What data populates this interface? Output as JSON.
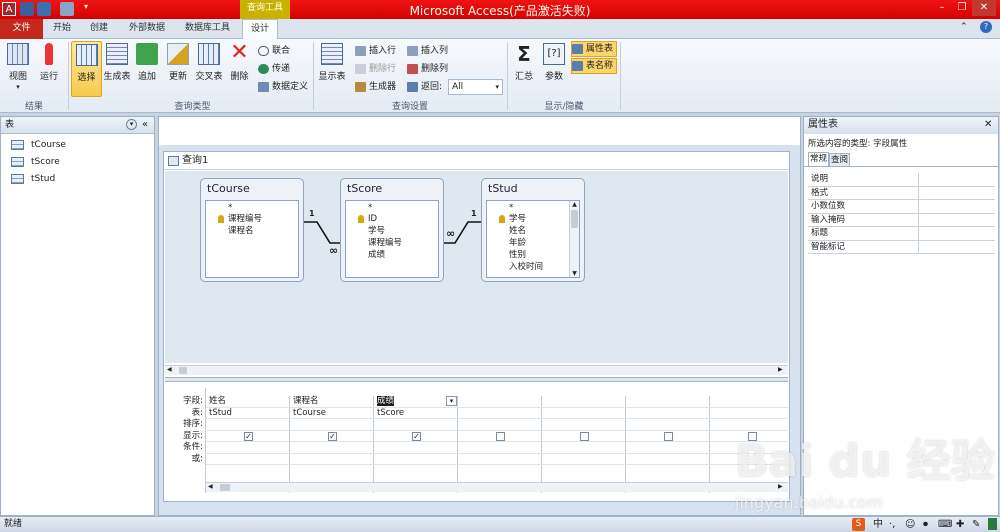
{
  "window": {
    "title": "Microsoft Access(产品激活失败)",
    "context_tab_title": "查询工具"
  },
  "tabs": [
    "文件",
    "开始",
    "创建",
    "外部数据",
    "数据库工具",
    "设计"
  ],
  "ribbon": {
    "groups": {
      "results": "结果",
      "query_type": "查询类型",
      "query_setup": "查询设置",
      "show_hide": "显示/隐藏"
    },
    "results": [
      "视图",
      "运行"
    ],
    "query_type": [
      "选择",
      "生成表",
      "追加",
      "更新",
      "交叉表",
      "删除"
    ],
    "query_type_small": [
      "联合",
      "传递",
      "数据定义"
    ],
    "show_table": "显示表",
    "setup_small": [
      "插入行",
      "删除行",
      "生成器",
      "插入列",
      "删除列",
      "返回:"
    ],
    "return_value": "All",
    "show_hide_big": [
      "汇总",
      "参数"
    ],
    "show_hide_small": [
      "属性表",
      "表名称"
    ]
  },
  "nav": {
    "header": "表",
    "items": [
      "tCourse",
      "tScore",
      "tStud"
    ]
  },
  "query": {
    "title": "查询1",
    "tables": [
      {
        "name": "tCourse",
        "fields": [
          "*",
          "课程编号",
          "课程名"
        ]
      },
      {
        "name": "tScore",
        "fields": [
          "*",
          "ID",
          "学号",
          "课程编号",
          "成绩"
        ]
      },
      {
        "name": "tStud",
        "fields": [
          "*",
          "学号",
          "姓名",
          "年龄",
          "性别",
          "入校时间"
        ]
      }
    ],
    "join_labels": {
      "one": "1",
      "many": "∞"
    },
    "grid_row_labels": [
      "字段:",
      "表:",
      "排序:",
      "显示:",
      "条件:",
      "或:"
    ],
    "grid_columns": [
      {
        "field": "姓名",
        "table": "tStud",
        "show": true
      },
      {
        "field": "课程名",
        "table": "tCourse",
        "show": true
      },
      {
        "field": "成绩",
        "table": "tScore",
        "show": true
      },
      {
        "field": "",
        "table": "",
        "show": false
      },
      {
        "field": "",
        "table": "",
        "show": false
      },
      {
        "field": "",
        "table": "",
        "show": false
      },
      {
        "field": "",
        "table": "",
        "show": false
      }
    ]
  },
  "property_sheet": {
    "title": "属性表",
    "selection_type": "所选内容的类型:  字段属性",
    "tabs": [
      "常规",
      "查阅"
    ],
    "rows": [
      "说明",
      "格式",
      "小数位数",
      "输入掩码",
      "标题",
      "智能标记"
    ]
  },
  "status": {
    "text": "就绪"
  },
  "watermark": {
    "logo": "Bai du 经验",
    "url": "jingyan.baidu.com"
  }
}
